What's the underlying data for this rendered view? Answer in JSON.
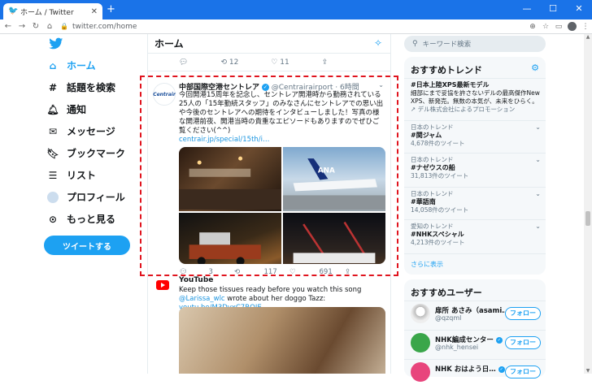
{
  "browser": {
    "tab_title": "ホーム / Twitter",
    "url": "twitter.com/home"
  },
  "nav": {
    "items": [
      {
        "label": "ホーム",
        "icon": "home-icon"
      },
      {
        "label": "話題を検索",
        "icon": "hashtag-icon"
      },
      {
        "label": "通知",
        "icon": "bell-icon"
      },
      {
        "label": "メッセージ",
        "icon": "mail-icon"
      },
      {
        "label": "ブックマーク",
        "icon": "bookmark-icon"
      },
      {
        "label": "リスト",
        "icon": "list-icon"
      },
      {
        "label": "プロフィール",
        "icon": "avatar-icon"
      },
      {
        "label": "もっと見る",
        "icon": "more-icon"
      }
    ],
    "tweet_button": "ツイートする"
  },
  "main": {
    "title": "ホーム",
    "prev_actions": {
      "retweets": "12",
      "likes": "11"
    },
    "tweet": {
      "avatar_text": "Centrair",
      "name": "中部国際空港セントレア",
      "handle": "@Centrairairport",
      "time": "· 6時間",
      "body": "今回開港15周年を記念し、セントレア開港時から勤務されている25人の「15年勤続スタッフ」のみなさんにセントレアでの思い出や今後のセントレアへの期待をインタビューしました！写真の様な開港前夜、開港当時の貴重なエピソードもありますのでぜひご覧ください(^^)",
      "link": "centrair.jp/special/15th/i…",
      "replies": "3",
      "retweets": "117",
      "likes": "691"
    },
    "next_tweet": {
      "name": "YouTube",
      "body_pre": "Keep those tissues ready before you watch this song ",
      "mention": "@Larissa_wlc",
      "body_mid": " wrote about her doggo Tazz: ",
      "link": "youtu.be/M3DyxC7RQIE"
    }
  },
  "right": {
    "search_placeholder": "キーワード検索",
    "trends_title": "おすすめトレンド",
    "trends": [
      {
        "context": "",
        "name": "#日本上陸XPS最新モデル",
        "desc": "細部にまで妥協を許さないデルの最高傑作New XPS、新発売。無数の本気が、未来をひらく。",
        "meta": "デル株式会社によるプロモーション"
      },
      {
        "context": "日本のトレンド",
        "name": "#関ジャム",
        "meta": "4,678件のツイート"
      },
      {
        "context": "日本のトレンド",
        "name": "#ナゼウスの船",
        "meta": "31,813件のツイート"
      },
      {
        "context": "日本のトレンド",
        "name": "#華語南",
        "meta": "14,058件のツイート"
      },
      {
        "context": "愛知のトレンド",
        "name": "#NHKスペシャル",
        "meta": "4,213件のツイート"
      }
    ],
    "show_more": "さらに表示",
    "users_title": "おすすめユーザー",
    "users": [
      {
        "name": "扉所 あさみ（asami…",
        "handle": "@qzqml",
        "follow": "フォロー"
      },
      {
        "name": "NHK編成センター",
        "handle": "@nhk_hensei",
        "follow": "フォロー"
      },
      {
        "name": "NHK おはよう日…",
        "handle": "",
        "follow": "フォロー"
      }
    ]
  }
}
